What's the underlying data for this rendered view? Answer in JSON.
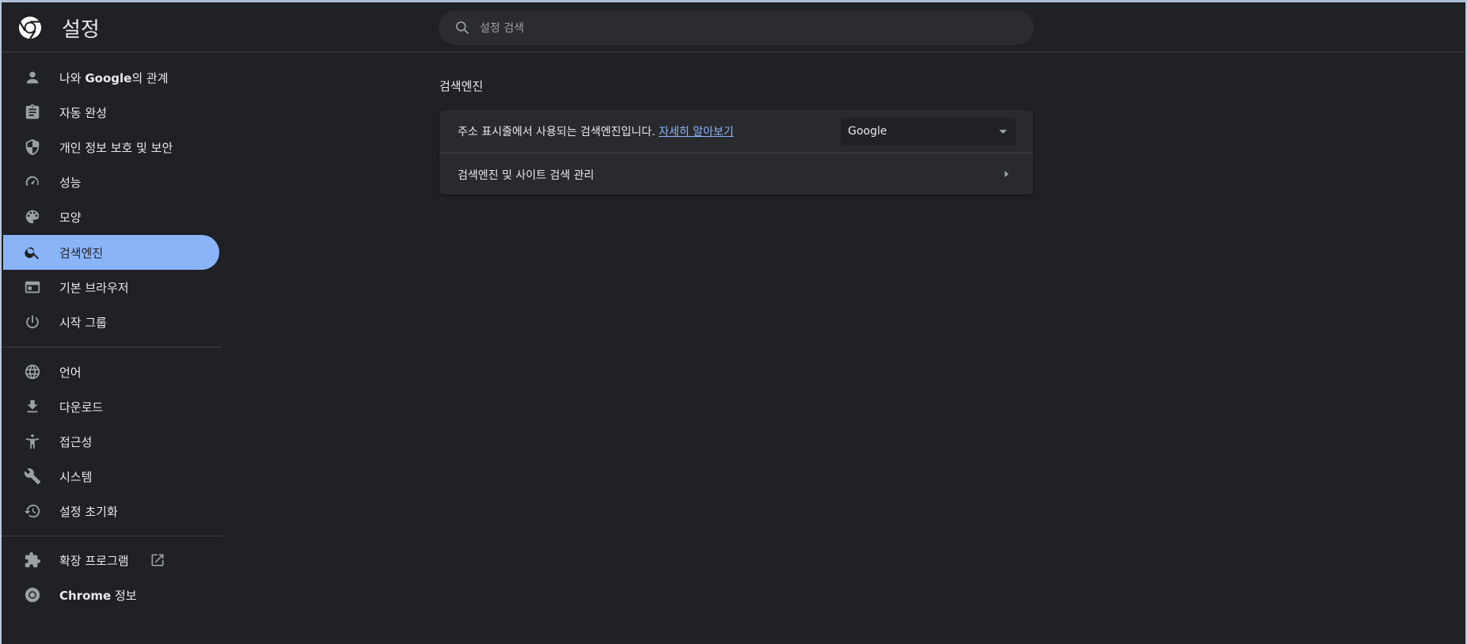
{
  "header": {
    "title": "설정",
    "search_placeholder": "설정 검색"
  },
  "sidebar": {
    "items": [
      {
        "label_pre": "나와 ",
        "label_bold": "Google",
        "label_post": "의 관계",
        "icon": "person-icon"
      },
      {
        "label": "자동 완성",
        "icon": "clipboard-icon"
      },
      {
        "label": "개인 정보 보호 및 보안",
        "icon": "shield-icon"
      },
      {
        "label": "성능",
        "icon": "speedometer-icon"
      },
      {
        "label": "모양",
        "icon": "palette-icon"
      },
      {
        "label": "검색엔진",
        "icon": "search-icon",
        "active": true
      },
      {
        "label": "기본 브라우저",
        "icon": "browser-window-icon"
      },
      {
        "label": "시작 그룹",
        "icon": "power-icon"
      },
      {
        "label": "언어",
        "icon": "globe-icon"
      },
      {
        "label": "다운로드",
        "icon": "download-icon"
      },
      {
        "label": "접근성",
        "icon": "accessibility-icon"
      },
      {
        "label": "시스템",
        "icon": "wrench-icon"
      },
      {
        "label": "설정 초기화",
        "icon": "restore-icon"
      },
      {
        "label": "확장 프로그램",
        "icon": "puzzle-icon",
        "external_icon": "open-in-new-icon"
      },
      {
        "label_bold": "Chrome",
        "label_post": " 정보",
        "icon": "chrome-icon"
      }
    ]
  },
  "main": {
    "section_title": "검색엔진",
    "row1_text": "주소 표시줄에서 사용되는 검색엔진입니다. ",
    "row1_link": "자세히 알아보기",
    "engine_selected": "Google",
    "row2_label": "검색엔진 및 사이트 검색 관리"
  },
  "colors": {
    "accent": "#8ab4f8",
    "background": "#202124",
    "card": "#292a2d"
  }
}
